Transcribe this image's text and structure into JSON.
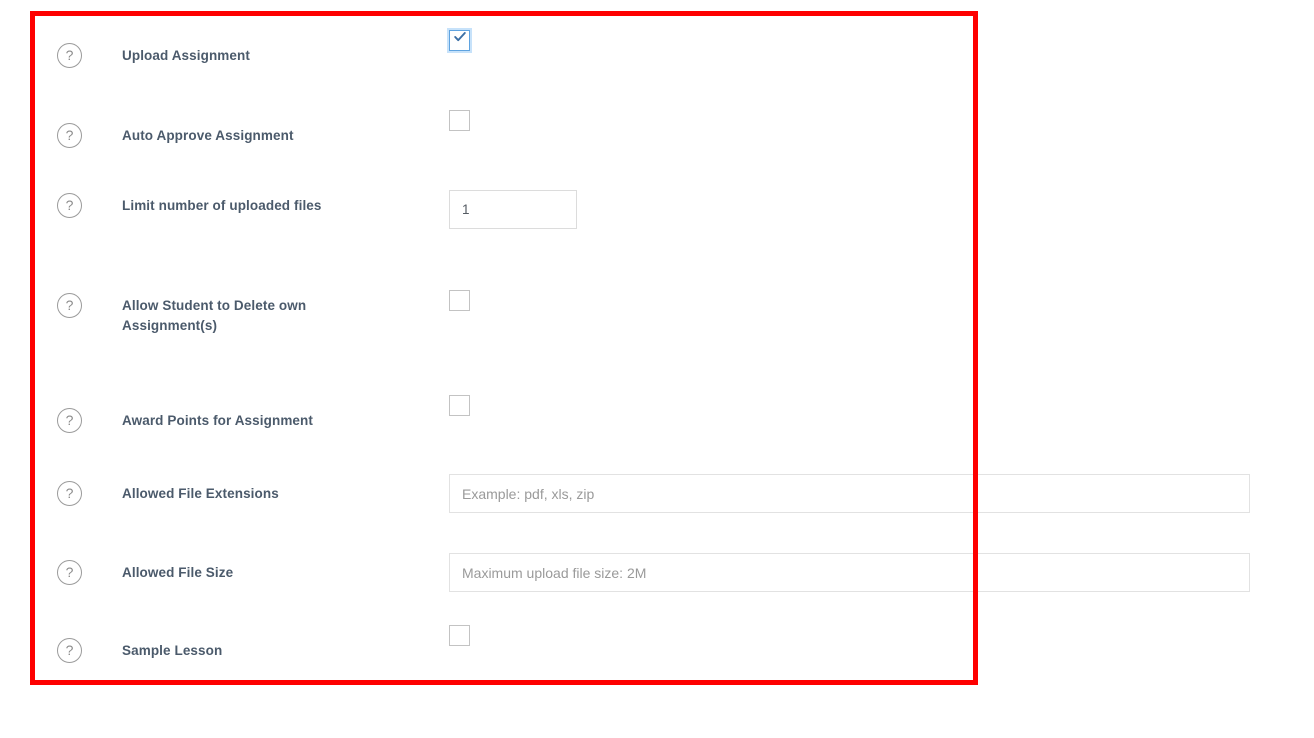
{
  "annotation": {
    "color": "#fe0000",
    "shape": "rectangle-highlight"
  },
  "theme": {
    "label_color": "#4b5a6b",
    "help_icon_color": "#8c8c8c",
    "input_border_color": "#e2e2e2",
    "placeholder_color": "#9a9a9a",
    "checkbox_checked_border": "#5fa3e0",
    "checkbox_check_color": "#3c6fa5",
    "checkbox_unchecked_border": "#c3c3c3"
  },
  "help_icon_glyph": "?",
  "form": {
    "rows": [
      {
        "id": "upload-assignment",
        "label": "Upload Assignment",
        "control": "checkbox",
        "checked": true,
        "help": "?"
      },
      {
        "id": "auto-approve-assignment",
        "label": "Auto Approve Assignment",
        "control": "checkbox",
        "checked": false,
        "help": "?"
      },
      {
        "id": "limit-number-of-uploaded-files",
        "label": "Limit number of uploaded files",
        "control": "number",
        "value": "1",
        "placeholder": "",
        "help": "?"
      },
      {
        "id": "allow-student-to-delete-own-assignments",
        "label": "Allow Student to Delete own Assignment(s)",
        "control": "checkbox",
        "checked": false,
        "help": "?"
      },
      {
        "id": "award-points-for-assignment",
        "label": "Award Points for Assignment",
        "control": "checkbox",
        "checked": false,
        "help": "?"
      },
      {
        "id": "allowed-file-extensions",
        "label": "Allowed File Extensions",
        "control": "text",
        "value": "",
        "placeholder": "Example: pdf, xls, zip",
        "help": "?"
      },
      {
        "id": "allowed-file-size",
        "label": "Allowed File Size",
        "control": "text",
        "value": "",
        "placeholder": "Maximum upload file size: 2M",
        "help": "?"
      },
      {
        "id": "sample-lesson",
        "label": "Sample Lesson",
        "control": "checkbox",
        "checked": false,
        "help": "?"
      }
    ]
  }
}
